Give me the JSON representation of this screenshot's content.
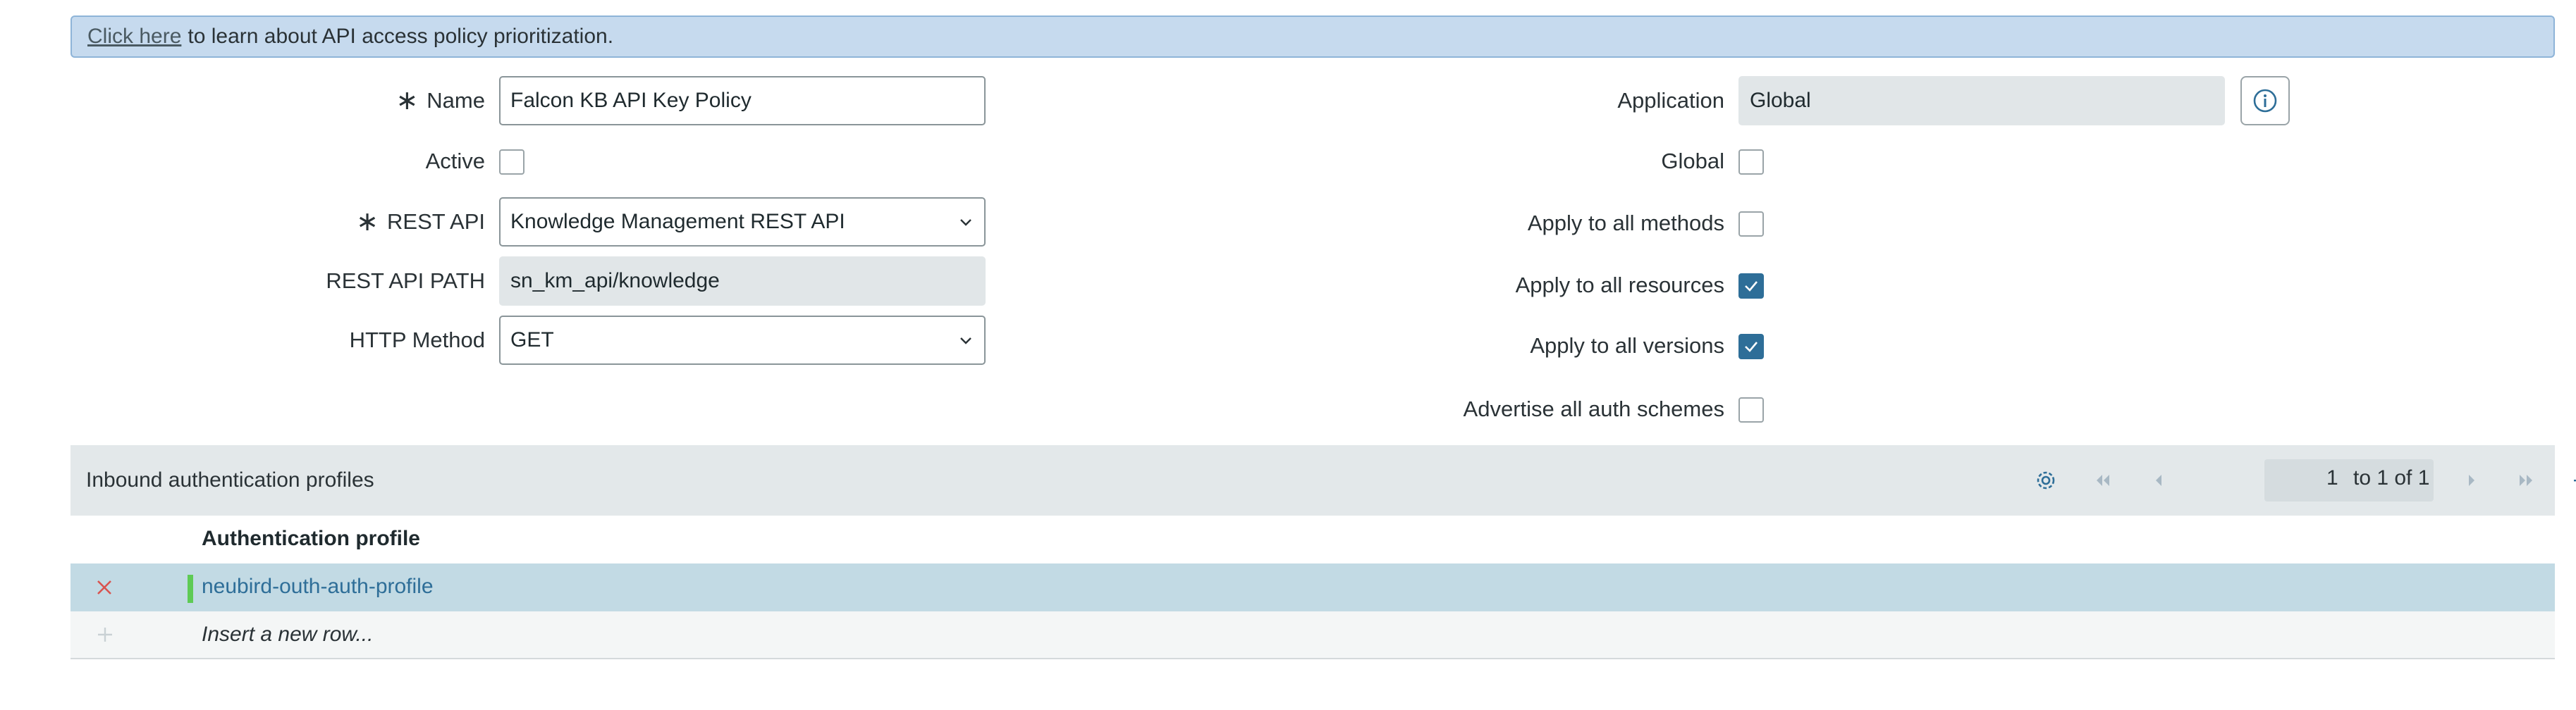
{
  "banner": {
    "link_text": "Click here",
    "text": "to learn about API access policy prioritization."
  },
  "form": {
    "name": {
      "label": "Name",
      "value": "Falcon KB API Key Policy"
    },
    "active": {
      "label": "Active",
      "checked": false
    },
    "rest_api": {
      "label": "REST API",
      "value": "Knowledge Management REST API"
    },
    "rest_api_path": {
      "label": "REST API PATH",
      "value": "sn_km_api/knowledge"
    },
    "http_method": {
      "label": "HTTP Method",
      "value": "GET"
    },
    "application": {
      "label": "Application",
      "value": "Global"
    },
    "global": {
      "label": "Global",
      "checked": false
    },
    "apply_all_methods": {
      "label": "Apply to all methods",
      "checked": false
    },
    "apply_all_resources": {
      "label": "Apply to all resources",
      "checked": true
    },
    "apply_all_versions": {
      "label": "Apply to all versions",
      "checked": true
    },
    "advertise_auth": {
      "label": "Advertise all auth schemes",
      "checked": false
    }
  },
  "related_list": {
    "title": "Inbound authentication profiles",
    "pager": {
      "current": "1",
      "text": "to 1 of 1"
    },
    "columns": [
      "Authentication profile"
    ],
    "rows": [
      {
        "profile": "neubird-outh-auth-profile"
      }
    ],
    "insert_placeholder": "Insert a new row..."
  },
  "colors": {
    "accent": "#2e6e98",
    "banner_bg": "#c6daee",
    "selected_row": "#c2dae4",
    "delete": "#d9534f",
    "row_marker": "#5ecb55"
  }
}
